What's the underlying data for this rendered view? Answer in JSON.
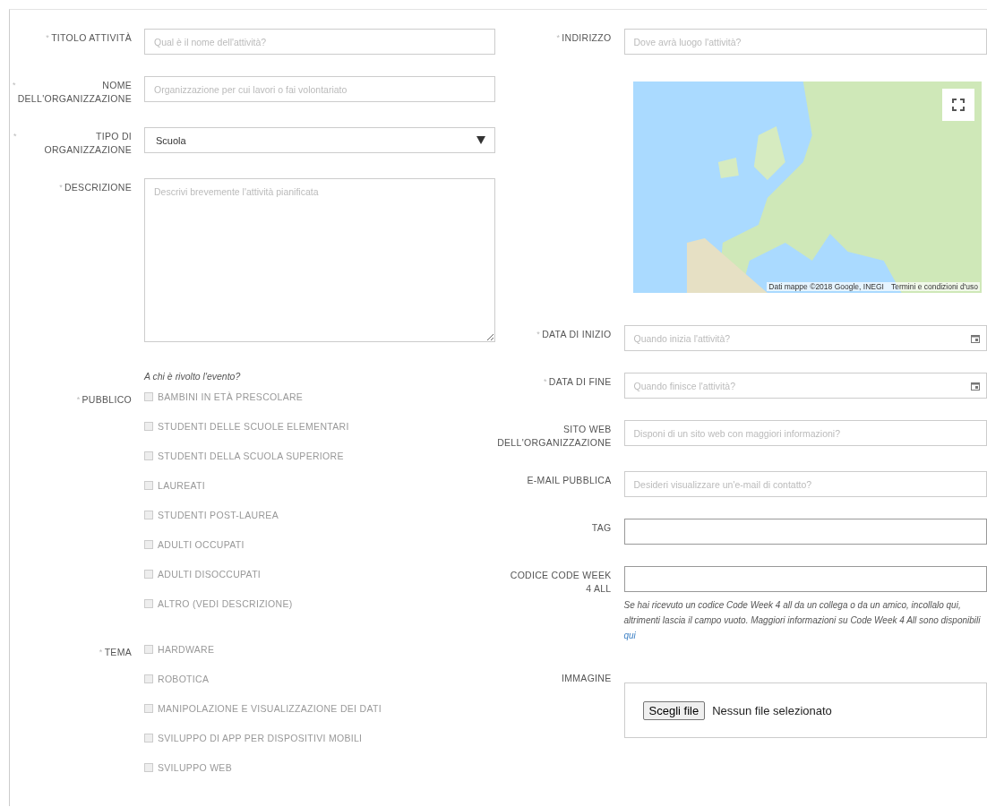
{
  "left": [
    {
      "kind": "text",
      "mark": "*",
      "label": "TITOLO ATTIVITÀ",
      "placeholder": "Qual è il nome dell'attività?"
    },
    {
      "kind": "text",
      "mark": "*",
      "label": "NOME DELL'ORGANIZZAZIONE",
      "placeholder": "Organizzazione per cui lavori o fai volontariato"
    },
    {
      "kind": "select",
      "mark": "*",
      "label": "TIPO DI ORGANIZZAZIONE",
      "value": "Scuola"
    },
    {
      "kind": "textarea",
      "mark": "*",
      "label": "DESCRIZIONE",
      "placeholder": "Descrivi brevemente l'attività pianificata"
    },
    {
      "kind": "checkboxes",
      "mark": "*",
      "label": "PUBBLICO",
      "intro": "A chi è rivolto l'evento?",
      "options": [
        {
          "label": "BAMBINI IN ETÀ PRESCOLARE",
          "checked": false
        },
        {
          "label": "STUDENTI DELLE SCUOLE ELEMENTARI",
          "checked": false
        },
        {
          "label": "STUDENTI DELLA SCUOLA SUPERIORE",
          "checked": false
        },
        {
          "label": "LAUREATI",
          "checked": false
        },
        {
          "label": "STUDENTI POST-LAUREA",
          "checked": false
        },
        {
          "label": "ADULTI OCCUPATI",
          "checked": false
        },
        {
          "label": "ADULTI DISOCCUPATI",
          "checked": false
        },
        {
          "label": "ALTRO (VEDI DESCRIZIONE)",
          "checked": false
        }
      ]
    },
    {
      "kind": "checkboxes",
      "mark": "*",
      "label": "TEMA",
      "options": [
        {
          "label": "HARDWARE",
          "checked": false
        },
        {
          "label": "ROBOTICA",
          "checked": false
        },
        {
          "label": "MANIPOLAZIONE E VISUALIZZAZIONE DEI DATI",
          "checked": false
        },
        {
          "label": "SVILUPPO DI APP PER DISPOSITIVI MOBILI",
          "checked": false
        },
        {
          "label": "SVILUPPO WEB",
          "checked": false
        }
      ]
    }
  ],
  "right": [
    {
      "kind": "text",
      "mark": "*",
      "label": "INDIRIZZO",
      "placeholder": "Dove avrà luogo l'attività?"
    },
    {
      "kind": "map",
      "attribution": "Dati mappe ©2018 Google, INEGI",
      "terms": "Termini e condizioni d'uso"
    },
    {
      "kind": "date",
      "mark": "*",
      "label": "DATA DI INIZIO",
      "placeholder": "Quando inizia l'attività?"
    },
    {
      "kind": "date",
      "mark": "*",
      "label": "DATA DI FINE",
      "placeholder": "Quando finisce l'attività?"
    },
    {
      "kind": "text",
      "label": "SITO WEB DELL'ORGANIZZAZIONE",
      "placeholder": "Disponi di un sito web con maggiori informazioni?"
    },
    {
      "kind": "text",
      "label": "E-MAIL PUBBLICA",
      "placeholder": "Desideri visualizzare un'e-mail di contatto?"
    },
    {
      "kind": "text",
      "label": "TAG"
    },
    {
      "kind": "text",
      "label": "CODICE CODE WEEK 4 ALL",
      "hint": "Se hai ricevuto un codice Code Week 4 all da un collega o da un amico, incollalo qui, altrimenti lascia il campo vuoto. Maggiori informazioni su Code Week 4 All sono disponibili",
      "hint_link": "qui"
    },
    {
      "kind": "file",
      "label": "IMMAGINE",
      "button": "Scegli file",
      "status": "Nessun file selezionato"
    }
  ]
}
